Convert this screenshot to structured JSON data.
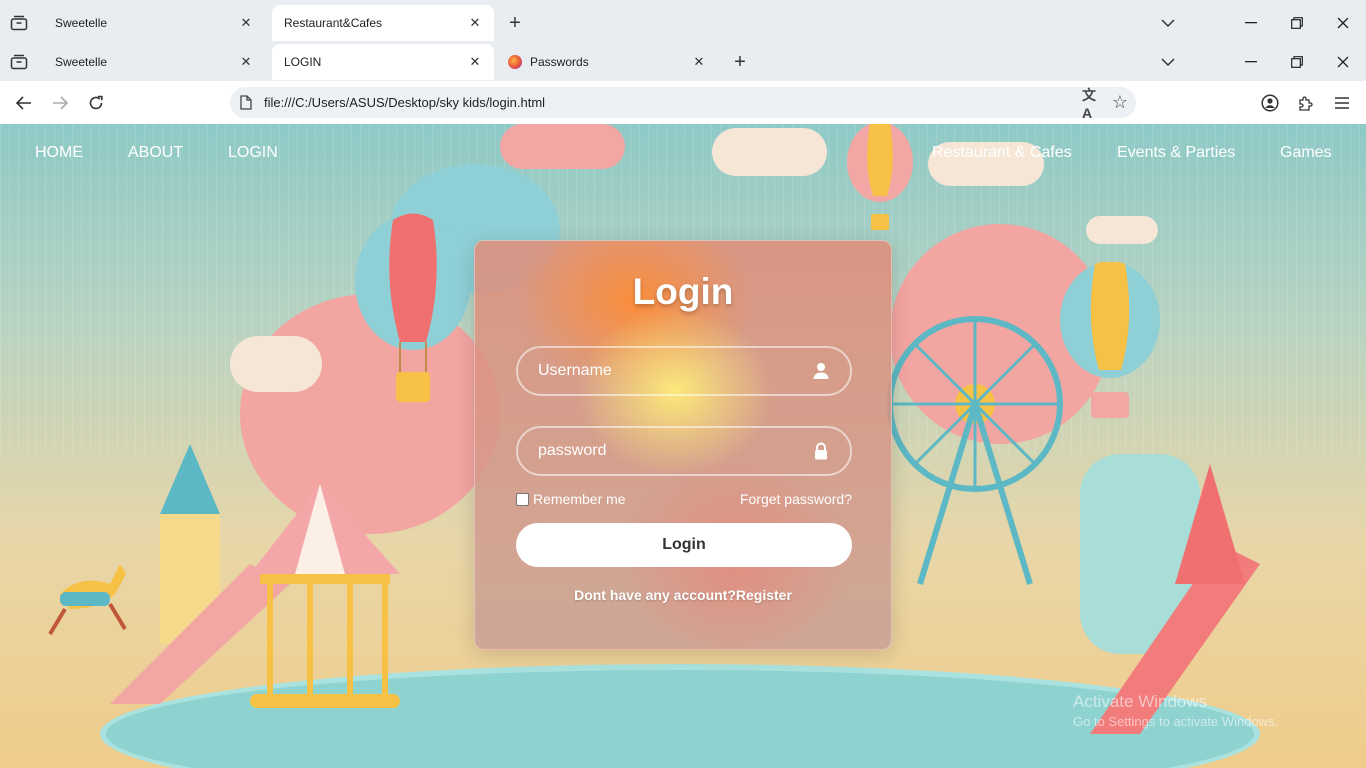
{
  "browser": {
    "row1_tabs": [
      {
        "title": "Sweetelle",
        "active": false
      },
      {
        "title": "Restaurant&Cafes",
        "active": true
      }
    ],
    "row2_tabs": [
      {
        "title": "Sweetelle",
        "active": false
      },
      {
        "title": "LOGIN",
        "active": true
      },
      {
        "title": "Passwords",
        "active": false
      }
    ],
    "url": "file:///C:/Users/ASUS/Desktop/sky kids/login.html"
  },
  "site_nav": {
    "left": [
      "HOME",
      "ABOUT",
      "LOGIN"
    ],
    "right": [
      "Restaurant & Cafes",
      "Events & Parties",
      "Games"
    ]
  },
  "login": {
    "title": "Login",
    "username_placeholder": "Username",
    "password_placeholder": "password",
    "remember_label": "Remember me",
    "forgot_label": "Forget password?",
    "button_label": "Login",
    "register_text": "Dont have any account?Register"
  },
  "watermark": {
    "line1": "Activate Windows",
    "line2": "Go to Settings to activate Windows."
  },
  "icons": {
    "tab_search": "tab-search-icon",
    "close": "close-icon",
    "new_tab": "plus-icon",
    "username": "user-icon",
    "password": "lock-icon"
  }
}
